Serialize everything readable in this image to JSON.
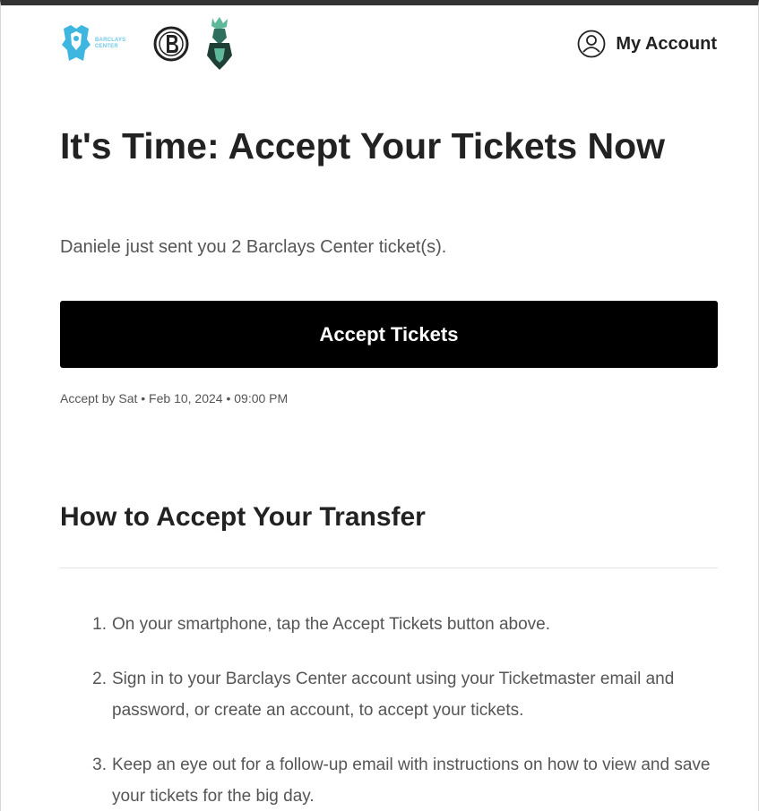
{
  "header": {
    "logos": {
      "barclays_wordmark_line1": "BARCLAYS",
      "barclays_wordmark_line2": "CENTER"
    },
    "account_label": "My Account"
  },
  "main": {
    "title": "It's Time: Accept Your Tickets Now",
    "subtitle": "Daniele just sent you 2 Barclays Center ticket(s).",
    "accept_button_label": "Accept Tickets",
    "deadline": "Accept by Sat • Feb 10, 2024 • 09:00 PM"
  },
  "instructions": {
    "heading": "How to Accept Your Transfer",
    "steps": [
      {
        "num": "1.",
        "text": "On your smartphone, tap the Accept Tickets button above."
      },
      {
        "num": "2.",
        "text": "Sign in to your Barclays Center account using your Ticketmaster email and password, or create an account, to accept your tickets."
      },
      {
        "num": "3.",
        "text": "Keep an eye out for a follow-up email with instructions on how to view and save your tickets for the big day."
      }
    ]
  },
  "colors": {
    "button_bg": "#000000",
    "button_text": "#ffffff",
    "barclays_accent": "#3fb6e0",
    "liberty_accent": "#2f6f5e"
  },
  "icons": [
    "barclays-center-logo",
    "brooklyn-nets-logo",
    "new-york-liberty-logo",
    "user-circle-icon"
  ]
}
